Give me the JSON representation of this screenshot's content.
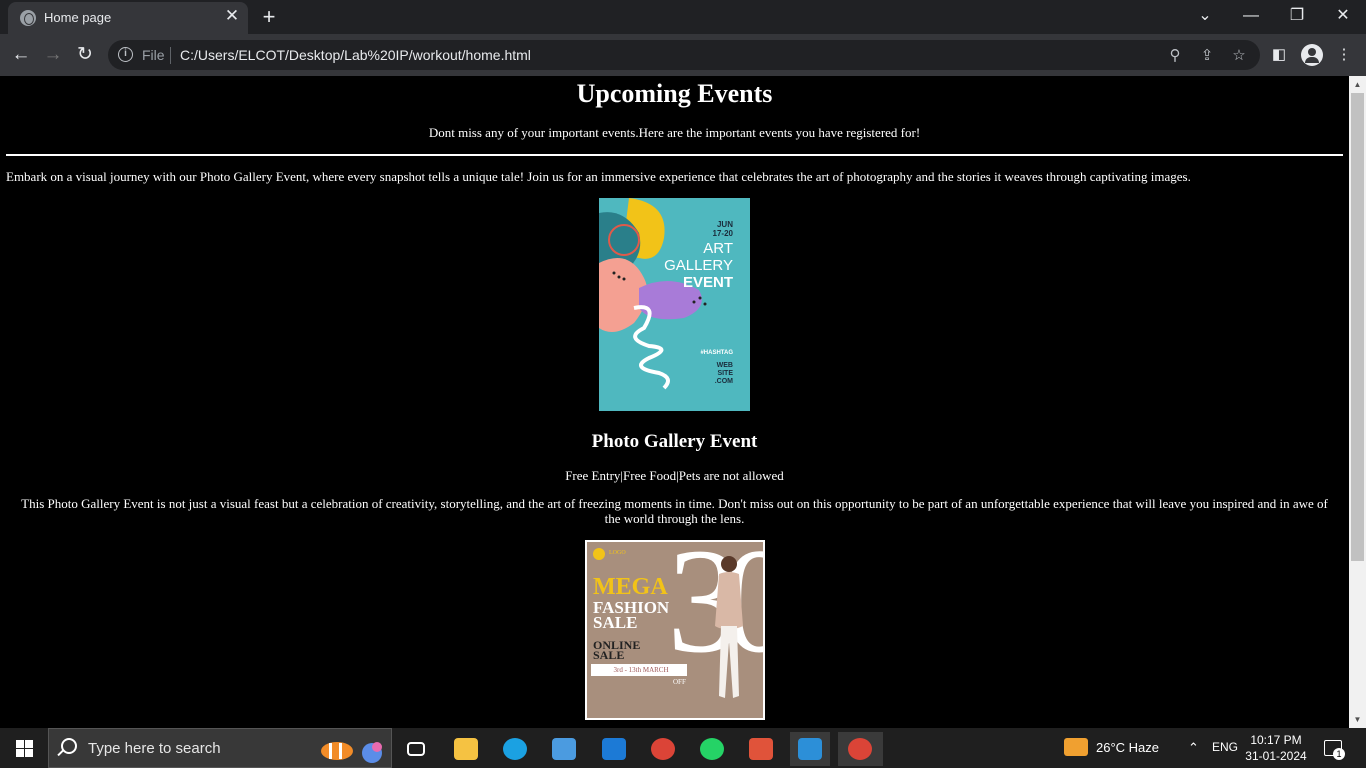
{
  "browser": {
    "tab_title": "Home page",
    "url_scheme": "File",
    "url": "C:/Users/ELCOT/Desktop/Lab%20IP/workout/home.html"
  },
  "page": {
    "title": "Upcoming Events",
    "subtitle": "Dont miss any of your important events.Here are the important events you have registered for!",
    "intro": "Embark on a visual journey with our Photo Gallery Event, where every snapshot tells a unique tale! Join us for an immersive experience that celebrates the art of photography and the stories it weaves through captivating images.",
    "poster1": {
      "date": "JUN\n17-20",
      "line1": "ART",
      "line2": "GALLERY",
      "line3": "EVENT",
      "hashtag": "#HASHTAG",
      "site": "WEB\nSITE\n.COM"
    },
    "event1": {
      "title": "Photo Gallery Event",
      "tags": "Free Entry|Free Food|Pets are not allowed",
      "description": "This Photo Gallery Event is not just a visual feast but a celebration of creativity, storytelling, and the art of freezing moments in time. Don't miss out on this opportunity to be part of an unforgettable experience that will leave you inspired and in awe of the world through the lens."
    },
    "poster2": {
      "logo": "LOGO",
      "mega": "MEGA",
      "fashion": "FASHION",
      "sale": "SALE",
      "online": "ONLINE",
      "sale2": "SALE",
      "dates": "3rd - 13th MARCH",
      "big_number": "30",
      "percent": "%",
      "off": "OFF"
    }
  },
  "taskbar": {
    "search_placeholder": "Type here to search",
    "weather": "26°C  Haze",
    "language": "ENG",
    "time": "10:17 PM",
    "date": "31-01-2024",
    "notifications": "1"
  },
  "colors": {
    "poster1_bg": "#4fb8bf",
    "poster2_bg": "#a88f7d",
    "accent_yellow": "#f2c318"
  }
}
